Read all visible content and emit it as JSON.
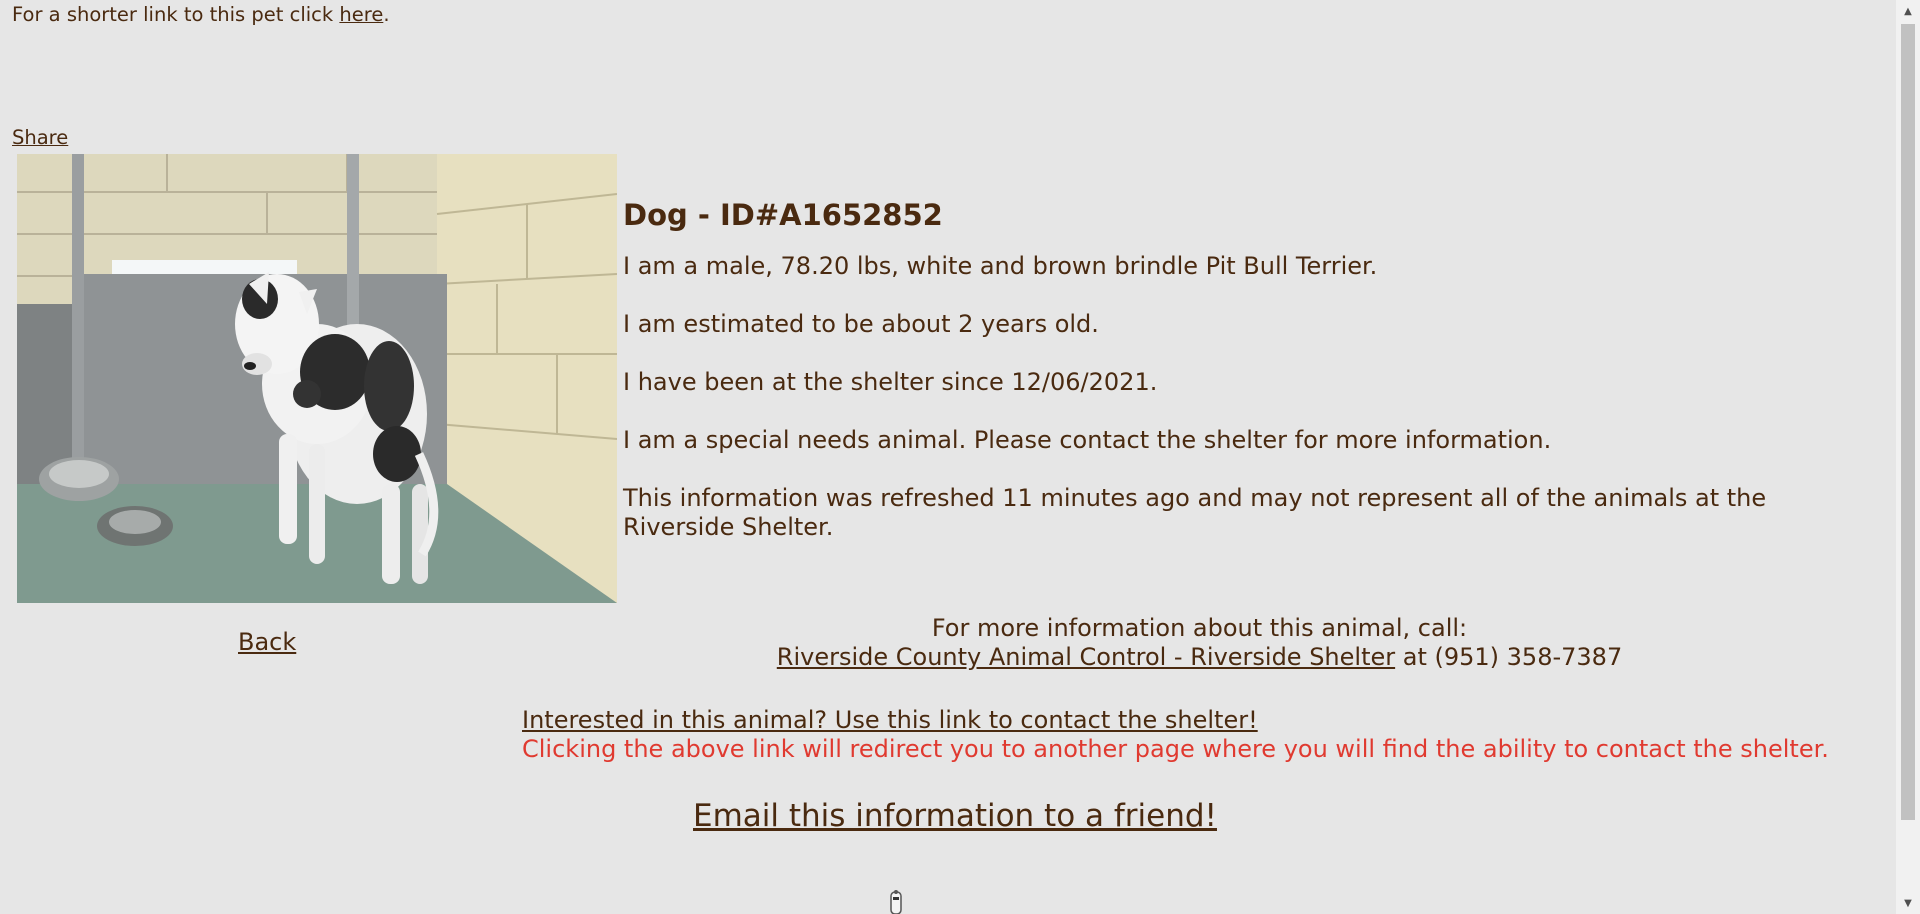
{
  "header": {
    "short_link_prefix": "For a shorter link to this pet click ",
    "short_link_label": "here",
    "short_link_suffix": ".",
    "share_label": "Share"
  },
  "animal": {
    "title": "Dog - ID#A1652852",
    "description": "I am a male, 78.20 lbs, white and brown brindle Pit Bull Terrier.",
    "age": "I am estimated to be about 2 years old.",
    "since": "I have been at the shelter since 12/06/2021.",
    "special_needs": "I am a special needs animal. Please contact the shelter for more information.",
    "refresh_note": "This information was refreshed 11 minutes ago and may not represent all of the animals at the Riverside Shelter."
  },
  "nav": {
    "back_label": "Back"
  },
  "contact": {
    "call_heading": "For more information about this animal, call:",
    "shelter_name": "Riverside County Animal Control - Riverside Shelter",
    "phone_text": " at (951) 358-7387",
    "interest_link": "Interested in this animal? Use this link to contact the shelter!",
    "redirect_note": "Clicking the above link will redirect you to another page where you will find the ability to contact the shelter.",
    "email_link": "Email this information to a friend!"
  },
  "colors": {
    "text": "#4a2a10",
    "warning": "#e03a30",
    "background": "#e6e6e6"
  },
  "icons": {
    "scroll_up": "scroll-up-arrow-icon",
    "scroll_down": "scroll-down-arrow-icon",
    "bottom_widget": "bottom-widget-icon"
  }
}
